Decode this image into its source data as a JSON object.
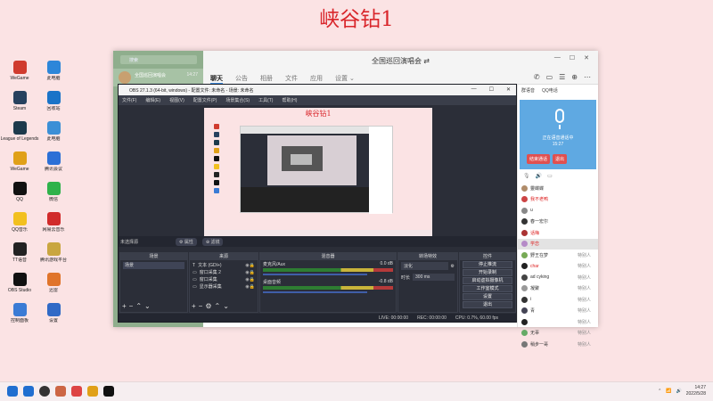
{
  "banner_title": "峡谷钻1",
  "desktop_icons": [
    {
      "label": "WeGame",
      "icon": "wegame-icon",
      "color": "#d03b2e",
      "col": 0
    },
    {
      "label": "Steam",
      "icon": "steam-icon",
      "color": "#27415e",
      "col": 0
    },
    {
      "label": "League of Legends",
      "icon": "lol-icon",
      "color": "#1d3a4c",
      "col": 0
    },
    {
      "label": "WeGame",
      "icon": "wegame-app-icon",
      "color": "#e0a018",
      "col": 0
    },
    {
      "label": "QQ",
      "icon": "qq-icon",
      "color": "#111111",
      "col": 0
    },
    {
      "label": "QQ音乐",
      "icon": "qqmusic-icon",
      "color": "#f2c01f",
      "col": 0
    },
    {
      "label": "TT语音",
      "icon": "tt-icon",
      "color": "#222222",
      "col": 0
    },
    {
      "label": "OBS Studio",
      "icon": "obs-icon",
      "color": "#111111",
      "col": 0
    },
    {
      "label": "控制面板",
      "icon": "control-panel-icon",
      "color": "#3a7bd5",
      "col": 0
    },
    {
      "label": "此电脑",
      "icon": "this-pc-icon",
      "color": "#2d86d9",
      "col": 1
    },
    {
      "label": "回收站",
      "icon": "recycle-bin-icon",
      "color": "#1a73c8",
      "col": 1
    },
    {
      "label": "此电脑",
      "icon": "computer-icon",
      "color": "#3b8fd6",
      "col": 1
    },
    {
      "label": "腾讯会议",
      "icon": "meeting-icon",
      "color": "#2b6fd6",
      "col": 1
    },
    {
      "label": "微信",
      "icon": "wechat-icon",
      "color": "#2fb24a",
      "col": 1
    },
    {
      "label": "网易云音乐",
      "icon": "netease-icon",
      "color": "#d12a2a",
      "col": 1
    },
    {
      "label": "腾讯游戏平台",
      "icon": "game-platform-icon",
      "color": "#c9a640",
      "col": 1
    },
    {
      "label": "迅雷",
      "icon": "xunlei-icon",
      "color": "#e0742a",
      "col": 1
    },
    {
      "label": "设置",
      "icon": "settings-icon",
      "color": "#3069c6",
      "col": 1
    }
  ],
  "qq": {
    "search_placeholder": "搜索",
    "conversation": {
      "name": "全国巡回演唱会",
      "time": "14:27"
    },
    "title": "全国巡回演唱会 ⇄",
    "tabs": [
      "聊天",
      "公告",
      "相册",
      "文件",
      "应用",
      "设置 ⌄"
    ],
    "window_controls": [
      "—",
      "☐",
      "✕"
    ],
    "tools": [
      "✆",
      "▭",
      "☰",
      "⊕",
      "⋯"
    ],
    "panel_tabs": [
      "群语音",
      "QQ电话"
    ],
    "voice": {
      "status_line1": "正在语音通话中",
      "status_line2": "15:27",
      "end_label": "结束通话",
      "quit_label": "退出"
    },
    "members": [
      {
        "name": "靈蝶蝶",
        "status": "",
        "color": "#b08c6a",
        "red": false
      },
      {
        "name": "我不老鸭",
        "status": "",
        "color": "#c44",
        "red": true
      },
      {
        "name": "u",
        "status": "",
        "color": "#888",
        "red": false
      },
      {
        "name": "春一宏尔",
        "status": "",
        "color": "#333",
        "red": false
      },
      {
        "name": "话梅",
        "status": "",
        "color": "#a33",
        "red": true
      },
      {
        "name": "学恋",
        "status": "",
        "color": "#b58ac7",
        "red": true,
        "selected": true
      },
      {
        "name": "野王在梦",
        "status": "特别人",
        "color": "#7a5",
        "red": false
      },
      {
        "name": "char",
        "status": "特别人",
        "color": "#222",
        "red": true
      },
      {
        "name": "ad cyking",
        "status": "特别人",
        "color": "#444",
        "red": false
      },
      {
        "name": "凝聚",
        "status": "特别人",
        "color": "#999",
        "red": false
      },
      {
        "name": "i",
        "status": "特别人",
        "color": "#333",
        "red": false
      },
      {
        "name": "青",
        "status": "特别人",
        "color": "#445",
        "red": false
      },
      {
        "name": "",
        "status": "特别人",
        "color": "#222",
        "red": false
      },
      {
        "name": "无辜",
        "status": "特别人",
        "color": "#6a6",
        "red": false
      },
      {
        "name": "稍步一哥",
        "status": "特别人",
        "color": "#777",
        "red": false
      }
    ]
  },
  "obs": {
    "title": "OBS 27.1.3 (64-bit, windows) - 配置文件: 未命名 - 场景: 未命名",
    "window_controls": [
      "—",
      "☐",
      "✕"
    ],
    "menu": [
      "文件(F)",
      "编辑(E)",
      "视图(V)",
      "配置文件(P)",
      "场景集合(S)",
      "工具(T)",
      "帮助(H)"
    ],
    "source_bar": {
      "label": "未选择源",
      "props": "⚙ 属性",
      "filters": "⊕ 滤镜"
    },
    "mini_title": "峡谷钻1",
    "docks": {
      "scenes": {
        "header": "场景",
        "items": [
          "场景"
        ]
      },
      "sources": {
        "header": "来源",
        "items": [
          "文本 (GDI+)",
          "窗口采集 2",
          "窗口采集",
          "显示器采集"
        ]
      },
      "mixer": {
        "header": "混音器",
        "channels": [
          {
            "name": "麦克风/Aux",
            "db": "0.0 dB"
          },
          {
            "name": "桌面音频",
            "db": "-0.8 dB"
          }
        ]
      },
      "transitions": {
        "header": "转场特效",
        "mode": "淡化",
        "duration_label": "时长",
        "duration": "300 ms"
      },
      "controls": {
        "header": "控件",
        "buttons": [
          "停止推流",
          "开始录制",
          "启动虚拟摄像机",
          "工作室模式",
          "设置",
          "退出"
        ]
      }
    },
    "status": {
      "live": "LIVE: 00:00:00",
      "rec": "REC: 00:00:00",
      "cpu": "CPU: 0.7%, 60.00 fps"
    }
  },
  "taskbar": {
    "time": "14:27",
    "date": "2022/5/28",
    "apps": [
      "#1f6fd0",
      "#333",
      "#c64",
      "#d44",
      "#e0a018",
      "#111"
    ]
  }
}
